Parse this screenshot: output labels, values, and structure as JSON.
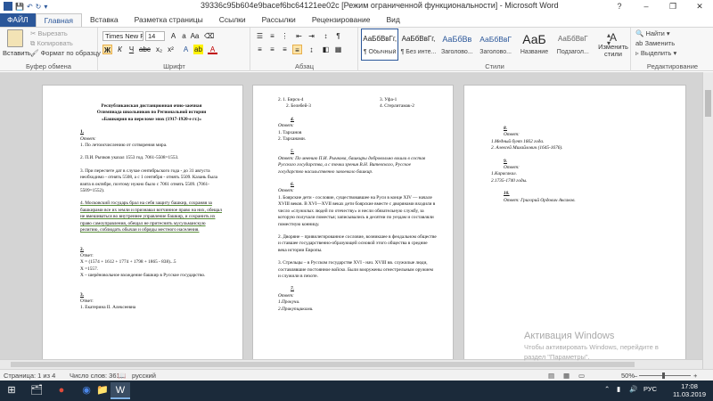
{
  "window": {
    "title": "39336c95b604e9bacef6bc64121ee02c [Режим ограниченной функциональности] - Microsoft Word",
    "help": "?",
    "minimize": "–",
    "restore": "❐",
    "close": "✕"
  },
  "tabs": [
    "ФАЙЛ",
    "Главная",
    "Вставка",
    "Разметка страницы",
    "Ссылки",
    "Рассылки",
    "Рецензирование",
    "Вид"
  ],
  "ribbon": {
    "clipboard": {
      "paste": "Вставить",
      "cut": "Вырезать",
      "copy": "Копировать",
      "format_painter": "Формат по образцу",
      "label": "Буфер обмена"
    },
    "font": {
      "name": "Times New Ro",
      "size": "14",
      "label": "Шрифт"
    },
    "paragraph": {
      "label": "Абзац"
    },
    "styles": {
      "items": [
        {
          "preview": "АаБбВвГг,",
          "name": "¶ Обычный"
        },
        {
          "preview": "АаБбВвГг,",
          "name": "¶ Без инте..."
        },
        {
          "preview": "АаБбВв",
          "name": "Заголово..."
        },
        {
          "preview": "АаБбВвГ",
          "name": "Заголово..."
        },
        {
          "preview": "АаБ",
          "name": "Название"
        },
        {
          "preview": "АаБбВвГ",
          "name": "Подзагол..."
        }
      ],
      "change": "Изменить стили",
      "label": "Стили"
    },
    "editing": {
      "find": "Найти",
      "replace": "Заменить",
      "select": "Выделить",
      "label": "Редактирование"
    }
  },
  "page1": {
    "h1": "Республиканская  дистанционная очно-заочная",
    "h2": "Олимпиада школьников  по Региональной  истории",
    "h3": "«Башкирия на переломе  эпох (1917-1920-е гг.)»",
    "q1": "1.",
    "ans1": "Ответ:",
    "l1": "1. По летоисчислению от сотворения мира.",
    "l2": "2. П.И. Рычков указал 1553 год. 7061-5508=1553.",
    "l3": "3. При пересчете дат в случае сентябрьского года - до 31 августа необходимо - отнять 5508, а с 1 сентября - отнять 5509. Казань была взята в октябре, поэтому нужно было с 7061 отнять 5509. (7061-5509=1552).",
    "l4": "4. Московский  государь брал на себя защиту  башкир, сохраняя за башкирами все их земли и признавал вотчинное право на них, обещал не вмешиваться  во внутреннее управление башкир, и сохранить их право самоуправления, обещал не притеснять мусульманскую религию, соблюдать обычаи и обряды местного населения.",
    "q2": "2.",
    "ans2": "Ответ:",
    "m1": "Х = (1574 + 1612 + 1774 + 1798 + 1865 - 838)...5",
    "m2": "Х =1557.",
    "m3": "Х – шерёновольное вхождение башкир в Русское государство.",
    "q3": "3.",
    "ans3": "Ответ:",
    "n1": "1. Екатерина II. Алексеевна"
  },
  "page2": {
    "c1a": "2.    1. Бирск-4",
    "c1b": "2. Белебей-3",
    "c2a": "3. Уфа-1",
    "c2b": "4. Стерлитамак-2",
    "q4": "4.",
    "ans4": "Ответ:",
    "a4_1": "1. Тарханов",
    "a4_2": "2. Тарханами.",
    "q5": "5.",
    "a5": "Ответ:  По мнению П.И. Рычкова,  башкиры добровольно вошли в состав Русского государства, а с точки зрения В.Н. Витевского, Русское государство насильственно завоевало башкир.",
    "q6": "6.",
    "ans6": "Ответ:",
    "a6_1": "1. Боярские дети - сословие, существовавшее  на Руси в конце XIV — начале XVIII веков.  В XVI—XVII веках дети боярские вместе с дворянами входили в число «служилых людей по отечеству» и несли обязательную службу, за которую получали поместья; записывались в десятни по уездам и составляли поместную конницу.",
    "a6_2": "2. Дворяне – привилегированное сословие, возникшее в феодальном обществе и ставшее  государственно-образующей основой этого общества в средние века истории Европы.",
    "a6_3": "3. Стрельцы – в Русском государстве XVI - нач.  XVIII вв.  служилые люди, составлявшие  постоянное войско.  Были вооружены огнестрельным оружием и служили в пехоте.",
    "q7": "7.",
    "ans7": "Ответ:",
    "a7_1": "1.Прокучи.",
    "a7_2": "2.Прикупщиками."
  },
  "page3": {
    "q8": "8.",
    "ans8": "Ответ:",
    "a8_1": "1.Медный бунт 1662 года.",
    "a8_2": "2. Алексей Михайлович (1645-1676).",
    "q9": "9.",
    "ans9": "Ответ:",
    "a9_1": "1.Карасакал.",
    "a9_2": "2.1735-1740 годы.",
    "q10": "10.",
    "a10": "Ответ: Григорий Ордович Аксаков."
  },
  "watermark": {
    "line1": "Активация Windows",
    "line2": "Чтобы активировать Windows, перейдите в",
    "line3": "раздел \"Параметры\"."
  },
  "status": {
    "page": "Страница: 1 из 4",
    "words": "Число слов: 361",
    "lang": "русский",
    "zoom_minus": "–",
    "zoom_plus": "+",
    "zoom": "50%"
  },
  "taskbar": {
    "lang": "РУС",
    "time": "17:08",
    "date": "11.03.2019"
  }
}
